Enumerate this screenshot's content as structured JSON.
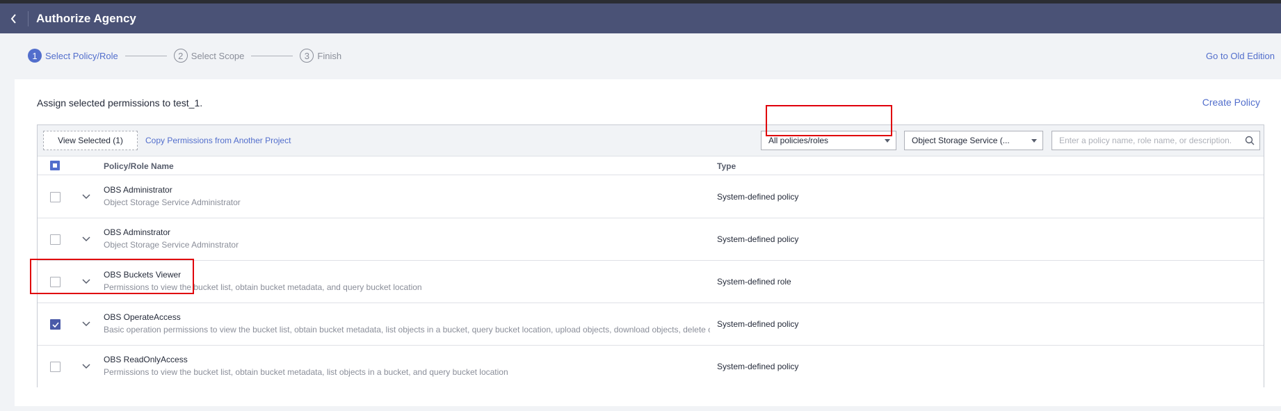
{
  "header": {
    "title": "Authorize Agency"
  },
  "steps": [
    {
      "number": "1",
      "label": "Select Policy/Role"
    },
    {
      "number": "2",
      "label": "Select Scope"
    },
    {
      "number": "3",
      "label": "Finish"
    }
  ],
  "old_edition_link": "Go to Old Edition",
  "assign_text": "Assign selected permissions to test_1.",
  "create_policy": "Create Policy",
  "toolbar": {
    "view_selected": "View Selected (1)",
    "copy_permissions": "Copy Permissions from Another Project",
    "filter_type": "All policies/roles",
    "filter_service": "Object Storage Service (...",
    "search_placeholder": "Enter a policy name, role name, or description."
  },
  "table": {
    "headers": {
      "name": "Policy/Role Name",
      "type": "Type"
    },
    "rows": [
      {
        "name": "OBS Administrator",
        "description": "Object Storage Service Administrator",
        "type": "System-defined policy",
        "checked": false
      },
      {
        "name": "OBS Adminstrator",
        "description": "Object Storage Service Adminstrator",
        "type": "System-defined policy",
        "checked": false
      },
      {
        "name": "OBS Buckets Viewer",
        "description": "Permissions to view the bucket list, obtain bucket metadata, and query bucket location",
        "type": "System-defined role",
        "checked": false
      },
      {
        "name": "OBS OperateAccess",
        "description": "Basic operation permissions to view the bucket list, obtain bucket metadata, list objects in a bucket, query bucket location, upload objects, download objects, delete objects, and obtain object ACLs",
        "type": "System-defined policy",
        "checked": true
      },
      {
        "name": "OBS ReadOnlyAccess",
        "description": "Permissions to view the bucket list, obtain bucket metadata, list objects in a bucket, and query bucket location",
        "type": "System-defined policy",
        "checked": false
      }
    ]
  },
  "colors": {
    "accent": "#526ecc",
    "header_bg": "#4a5276",
    "highlight": "#e0000b"
  }
}
